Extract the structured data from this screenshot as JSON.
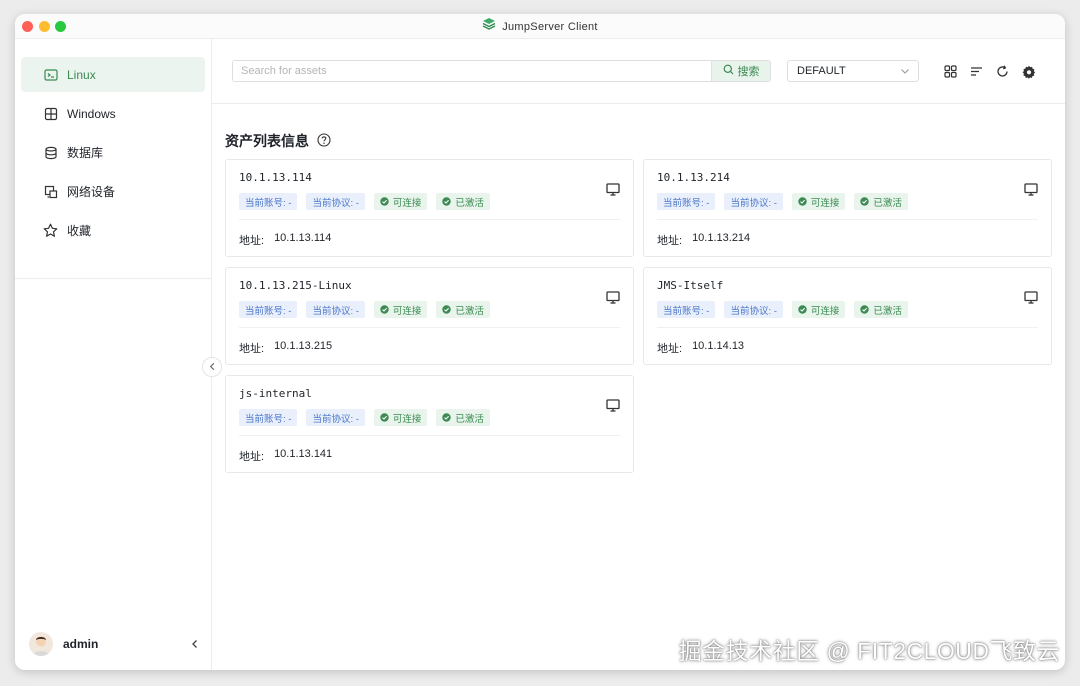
{
  "window": {
    "title": "JumpServer Client"
  },
  "sidebar": {
    "items": [
      {
        "label": "Linux",
        "icon": "terminal-icon",
        "active": true
      },
      {
        "label": "Windows",
        "icon": "windows-icon",
        "active": false
      },
      {
        "label": "数据库",
        "icon": "database-icon",
        "active": false
      },
      {
        "label": "网络设备",
        "icon": "network-device-icon",
        "active": false
      },
      {
        "label": "收藏",
        "icon": "star-icon",
        "active": false
      }
    ],
    "user": {
      "name": "admin"
    }
  },
  "toolbar": {
    "search_placeholder": "Search for assets",
    "search_button": "搜索",
    "select_value": "DEFAULT"
  },
  "main": {
    "section_title": "资产列表信息"
  },
  "assets": [
    {
      "name": "10.1.13.114",
      "account_tag": "当前账号: -",
      "protocol_tag": "当前协议: -",
      "connect_tag": "可连接",
      "active_tag": "已激活",
      "address_label": "地址:",
      "address": "10.1.13.114"
    },
    {
      "name": "10.1.13.214",
      "account_tag": "当前账号: -",
      "protocol_tag": "当前协议: -",
      "connect_tag": "可连接",
      "active_tag": "已激活",
      "address_label": "地址:",
      "address": "10.1.13.214"
    },
    {
      "name": "10.1.13.215-Linux",
      "account_tag": "当前账号: -",
      "protocol_tag": "当前协议: -",
      "connect_tag": "可连接",
      "active_tag": "已激活",
      "address_label": "地址:",
      "address": "10.1.13.215"
    },
    {
      "name": "JMS-Itself",
      "account_tag": "当前账号: -",
      "protocol_tag": "当前协议: -",
      "connect_tag": "可连接",
      "active_tag": "已激活",
      "address_label": "地址:",
      "address": "10.1.14.13"
    },
    {
      "name": "js-internal",
      "account_tag": "当前账号: -",
      "protocol_tag": "当前协议: -",
      "connect_tag": "可连接",
      "active_tag": "已激活",
      "address_label": "地址:",
      "address": "10.1.13.141"
    }
  ],
  "watermark": "掘金技术社区 @ FIT2CLOUD飞致云",
  "colors": {
    "accent": "#3a8a52",
    "accent_bg": "#ebf4ee",
    "tag_blue": "#4a76c9",
    "tag_blue_bg": "#eaf0fb"
  }
}
